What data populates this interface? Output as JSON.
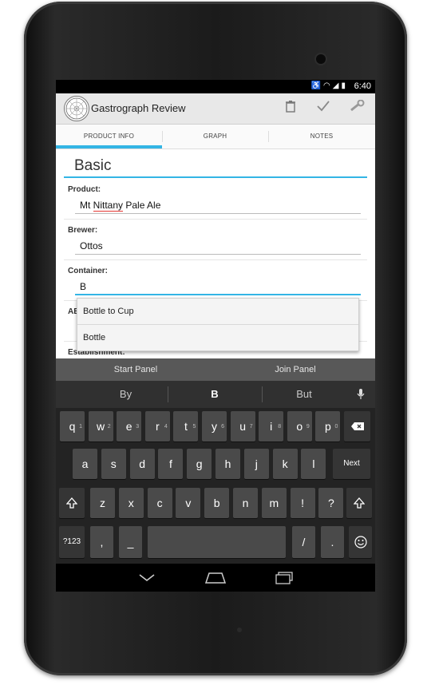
{
  "app": {
    "title": "Gastrograph Review",
    "logo_icon": "gastrograph-logo"
  },
  "status": {
    "time": "6:40",
    "icons": [
      "accessibility-icon",
      "wifi-icon",
      "signal-icon",
      "battery-icon"
    ]
  },
  "actionbar": {
    "buttons": [
      "trash-icon",
      "check-icon",
      "wrench-icon"
    ]
  },
  "tabs": [
    {
      "label": "PRODUCT INFO",
      "active": true
    },
    {
      "label": "GRAPH",
      "active": false
    },
    {
      "label": "NOTES",
      "active": false
    }
  ],
  "form": {
    "section_title": "Basic",
    "product": {
      "label": "Product:",
      "value_prefix": "Mt ",
      "value_misspelled": "Nittany",
      "value_suffix": " Pale Ale"
    },
    "brewer": {
      "label": "Brewer:",
      "value": "Ottos"
    },
    "container": {
      "label": "Container:",
      "value": "B"
    },
    "abv_partial_label": "AB",
    "establishment_label": "Establishment:"
  },
  "autocomplete": {
    "options": [
      "Bottle to Cup",
      "Bottle"
    ]
  },
  "panel_bar": {
    "start": "Start Panel",
    "join": "Join Panel"
  },
  "keyboard": {
    "suggestions": [
      "By",
      "B",
      "But"
    ],
    "row1": [
      {
        "k": "q",
        "h": "1"
      },
      {
        "k": "w",
        "h": "2"
      },
      {
        "k": "e",
        "h": "3"
      },
      {
        "k": "r",
        "h": "4"
      },
      {
        "k": "t",
        "h": "5"
      },
      {
        "k": "y",
        "h": "6"
      },
      {
        "k": "u",
        "h": "7"
      },
      {
        "k": "i",
        "h": "8"
      },
      {
        "k": "o",
        "h": "9"
      },
      {
        "k": "p",
        "h": "0"
      }
    ],
    "row2": [
      "a",
      "s",
      "d",
      "f",
      "g",
      "h",
      "j",
      "k",
      "l"
    ],
    "row3": [
      "z",
      "x",
      "c",
      "v",
      "b",
      "n",
      "m",
      "!",
      "?"
    ],
    "next_label": "Next",
    "symbols_label": "?123",
    "comma_label": ",",
    "underscore_label": "_",
    "slash_label": "/",
    "period_label": ".",
    "accent_color": "#33b5e5"
  },
  "navbar": {
    "buttons": [
      "back-icon",
      "home-icon",
      "recents-icon"
    ]
  }
}
